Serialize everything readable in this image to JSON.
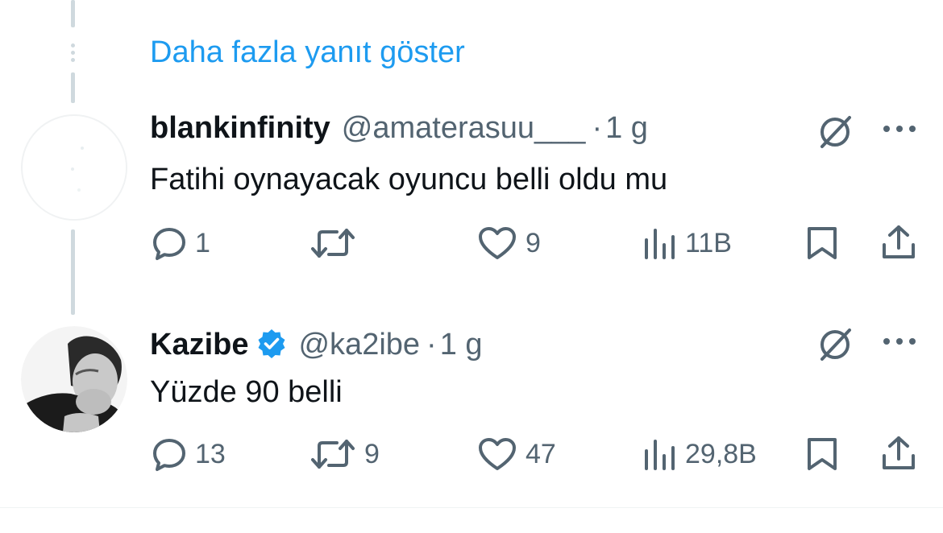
{
  "thread": {
    "show_more_label": "Daha fazla yanıt göster"
  },
  "tweets": [
    {
      "display_name": "blankinfinity",
      "handle": "@amaterasuu___",
      "separator": "·",
      "time": "1 g",
      "verified": false,
      "text": "Fatihi oynayacak oyuncu belli oldu mu",
      "replies": "1",
      "retweets": "",
      "likes": "9",
      "views": "11B"
    },
    {
      "display_name": "Kazibe",
      "handle": "@ka2ibe",
      "separator": "·",
      "time": "1 g",
      "verified": true,
      "text": "Yüzde 90 belli",
      "replies": "13",
      "retweets": "9",
      "likes": "47",
      "views": "29,8B"
    }
  ],
  "colors": {
    "link": "#1d9bf0",
    "muted": "#536471",
    "text": "#0f1419",
    "thread_line": "#cfd9de",
    "verified": "#1d9bf0"
  },
  "icons": [
    "reply-icon",
    "retweet-icon",
    "like-icon",
    "views-icon",
    "bookmark-icon",
    "share-icon",
    "grok-icon",
    "more-icon",
    "verified-badge-icon"
  ]
}
